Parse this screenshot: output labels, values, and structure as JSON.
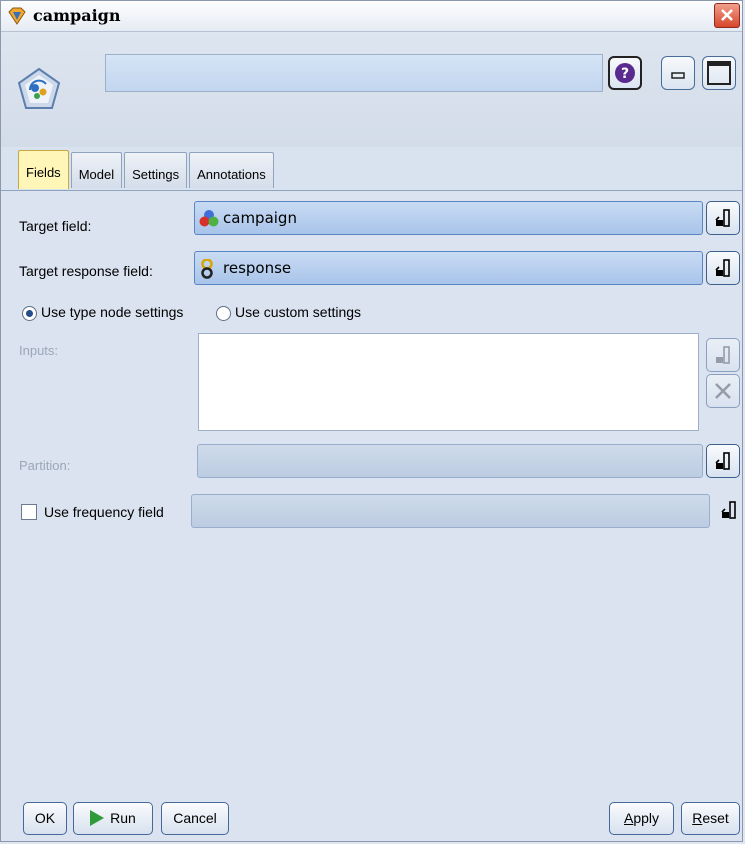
{
  "window": {
    "title": "campaign",
    "node_name_value": ""
  },
  "header": {
    "help_icon": "help-icon",
    "minimize_icon": "minimize-icon",
    "maximize_icon": "maximize-icon"
  },
  "tabs": [
    {
      "label": "Fields",
      "active": true
    },
    {
      "label": "Model",
      "active": false
    },
    {
      "label": "Settings",
      "active": false
    },
    {
      "label": "Annotations",
      "active": false
    }
  ],
  "fields": {
    "target_label": "Target field:",
    "target_value": "campaign",
    "target_response_label": "Target response field:",
    "target_response_value": "response",
    "radio_type_node": "Use type node settings",
    "radio_custom": "Use custom settings",
    "radio_selected": "type_node",
    "inputs_label": "Inputs:",
    "partition_label": "Partition:",
    "partition_value": "",
    "use_frequency_label": "Use frequency field",
    "use_frequency_checked": false,
    "frequency_value": ""
  },
  "buttons": {
    "ok": "OK",
    "run": "Run",
    "cancel": "Cancel",
    "apply_prefix": "A",
    "apply_rest": "pply",
    "reset_prefix": "R",
    "reset_rest": "eset"
  },
  "colors": {
    "active_tab": "#fff6b8",
    "field_bg": "#b9d0ef",
    "close_button": "#d6462b",
    "run_icon": "#2f9b3a"
  }
}
